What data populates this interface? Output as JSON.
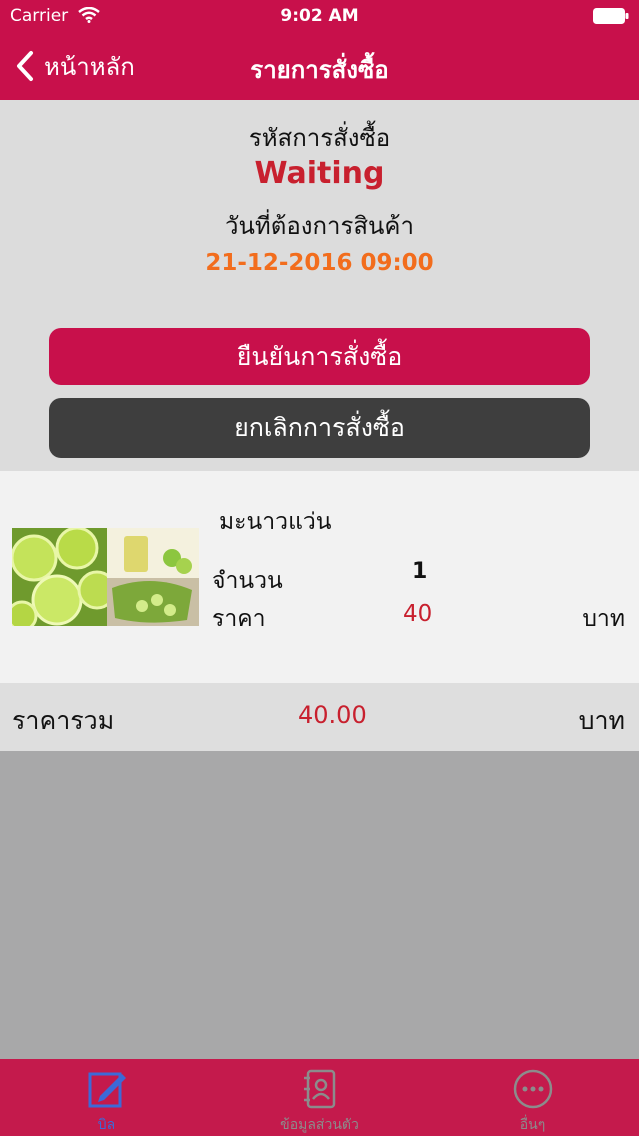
{
  "status_bar": {
    "carrier": "Carrier",
    "time": "9:02 AM"
  },
  "nav": {
    "back_label": "หน้าหลัก",
    "title": "รายการสั่งซื้อ"
  },
  "order": {
    "code_label": "รหัสการสั่งซื้อ",
    "status": "Waiting",
    "delivery_label": "วันที่ต้องการสินค้า",
    "delivery_datetime": "21-12-2016 09:00",
    "status_color": "#c8202e",
    "date_color": "#f26d1d"
  },
  "actions": {
    "confirm_label": "ยืนยันการสั่งซื้อ",
    "cancel_label": "ยกเลิกการสั่งซื้อ"
  },
  "items": [
    {
      "name": "มะนาวแว่น",
      "image_icon": "lime-photo",
      "qty_label": "จำนวน",
      "qty": "1",
      "price_label": "ราคา",
      "price": "40",
      "unit": "บาท"
    }
  ],
  "total": {
    "label": "ราคารวม",
    "value": "40.00",
    "unit": "บาท"
  },
  "tabs": [
    {
      "label": "บิล",
      "icon": "edit-icon",
      "active": true
    },
    {
      "label": "ข้อมูลส่วนตัว",
      "icon": "contacts-icon",
      "active": false
    },
    {
      "label": "อื่นๆ",
      "icon": "more-icon",
      "active": false
    }
  ],
  "colors": {
    "brand": "#c8104b",
    "dark_button": "#3e3e3e",
    "active_tab": "#3c6ad8"
  }
}
